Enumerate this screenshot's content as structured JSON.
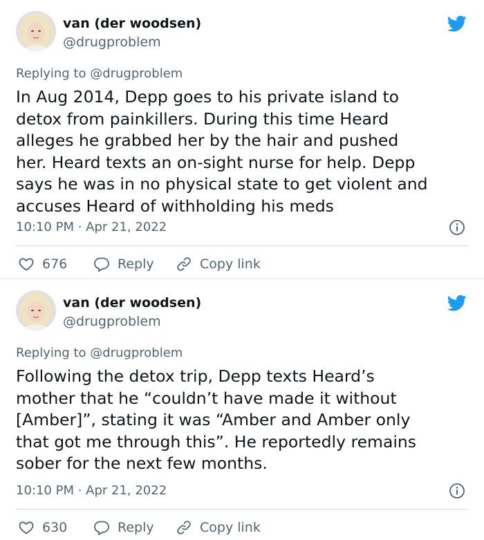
{
  "tweets": [
    {
      "author_name": "van (der woodsen)",
      "author_handle": "@drugproblem",
      "replying_to": "Replying to @drugproblem",
      "body_lines": [
        "In Aug 2014, Depp goes to his private island to",
        "detox from painkillers. During this time Heard",
        "alleges he grabbed her by the hair and pushed",
        "her. Heard texts an on-sight nurse for help. Depp",
        "says he was in no physical state to get violent and",
        "accuses Heard of withholding his meds"
      ],
      "timestamp": "10:10 PM · Apr 21, 2022",
      "likes": "676",
      "reply_label": "Reply",
      "copy_link_label": "Copy link"
    },
    {
      "author_name": "van (der woodsen)",
      "author_handle": "@drugproblem",
      "replying_to": "Replying to @drugproblem",
      "body_lines": [
        "Following the detox trip, Depp texts Heard’s",
        "mother that he “couldn’t have made it without",
        "[Amber]”, stating it was “Amber and Amber only",
        "that got me through this”. He reportedly remains",
        "sober for the next few months."
      ],
      "timestamp": "10:10 PM · Apr 21, 2022",
      "likes": "630",
      "reply_label": "Reply",
      "copy_link_label": "Copy link"
    }
  ],
  "colors": {
    "primary_text": "#0f1419",
    "secondary_text": "#536471",
    "twitter_blue": "#1d9bf0",
    "divider": "#cfd9de"
  },
  "icons": [
    "twitter-bird-icon",
    "info-icon",
    "heart-icon",
    "reply-icon",
    "link-icon"
  ]
}
